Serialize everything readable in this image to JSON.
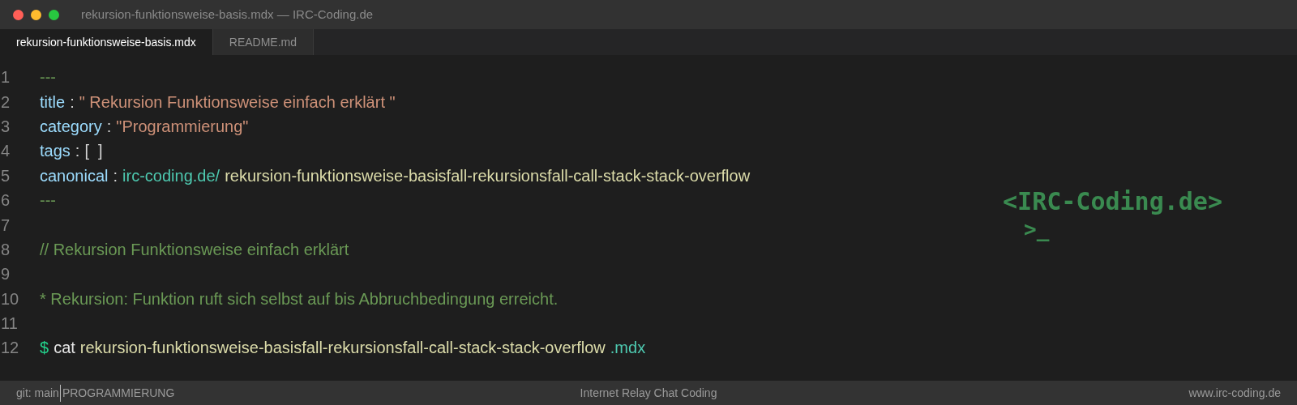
{
  "window": {
    "title": "rekursion-funktionsweise-basis.mdx — IRC-Coding.de"
  },
  "tabs": [
    {
      "label": "rekursion-funktionsweise-basis.mdx",
      "selected": true
    },
    {
      "label": "README.md",
      "selected": false
    }
  ],
  "editor": {
    "lines": [
      {
        "number": "1",
        "tokens": [
          {
            "kind": "rule",
            "text": "---"
          }
        ]
      },
      {
        "number": "2",
        "tokens": [
          {
            "kind": "key",
            "text": "title"
          },
          {
            "kind": "punct",
            "text": ":"
          },
          {
            "kind": "string",
            "text": "\" Rekursion Funktionsweise einfach erklärt \""
          }
        ]
      },
      {
        "number": "3",
        "tokens": [
          {
            "kind": "key",
            "text": "category"
          },
          {
            "kind": "punct",
            "text": ":"
          },
          {
            "kind": "string",
            "text": "\"Programmierung\""
          }
        ]
      },
      {
        "number": "4",
        "tokens": [
          {
            "kind": "key",
            "text": "tags"
          },
          {
            "kind": "punct",
            "text": ":"
          },
          {
            "kind": "punct",
            "text": "[  ]"
          }
        ]
      },
      {
        "number": "5",
        "tokens": [
          {
            "kind": "key",
            "text": "canonical"
          },
          {
            "kind": "punct",
            "text": ":"
          },
          {
            "kind": "url",
            "text": "irc-coding.de/"
          },
          {
            "kind": "value",
            "text": "rekursion-funktionsweise-basisfall-rekursionsfall-call-stack-stack-overflow"
          }
        ]
      },
      {
        "number": "6",
        "tokens": [
          {
            "kind": "rule",
            "text": "---"
          }
        ]
      },
      {
        "number": "7"
      },
      {
        "number": "8",
        "tokens": [
          {
            "kind": "comment",
            "text": "// Rekursion Funktionsweise einfach erklärt"
          }
        ]
      },
      {
        "number": "9"
      },
      {
        "number": "10",
        "tokens": [
          {
            "kind": "comment",
            "text": "* Rekursion: Funktion ruft sich selbst auf bis Abbruchbedingung erreicht."
          }
        ]
      },
      {
        "number": "11"
      },
      {
        "number": "12",
        "tokens": [
          {
            "kind": "prompt",
            "text": "$"
          },
          {
            "kind": "command",
            "text": "cat"
          },
          {
            "kind": "value",
            "text": "rekursion-funktionsweise-basisfall-rekursionsfall-call-stack-stack-overflow"
          },
          {
            "kind": "url",
            "text": ".mdx"
          }
        ]
      }
    ]
  },
  "logo": {
    "text": "<IRC-Coding.de>",
    "cursor": ">_"
  },
  "status_bar": {
    "branch": "git: main",
    "category": "PROGRAMMIERUNG",
    "center": "Internet Relay Chat Coding",
    "right": "www.irc-coding.de"
  }
}
